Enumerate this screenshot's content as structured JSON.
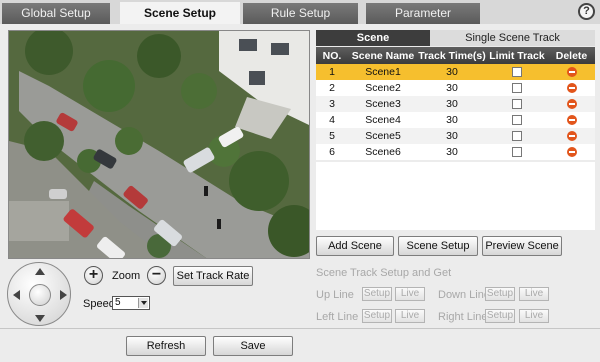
{
  "tabs": [
    {
      "label": "Global Setup"
    },
    {
      "label": "Scene Setup"
    },
    {
      "label": "Rule Setup"
    },
    {
      "label": "Parameter"
    }
  ],
  "help_label": "?",
  "ptz": {
    "zoom_label": "Zoom",
    "zoom_in": "+",
    "zoom_out": "−",
    "set_track_rate": "Set Track Rate",
    "speed_label": "Speed",
    "speed_value": "5"
  },
  "scene_tabs": {
    "scene": "Scene",
    "single": "Single Scene Track"
  },
  "table": {
    "headers": [
      "NO.",
      "Scene Name",
      "Track Time(s)",
      "Limit Track",
      "Delete"
    ],
    "rows": [
      {
        "no": "1",
        "name": "Scene1",
        "time": "30"
      },
      {
        "no": "2",
        "name": "Scene2",
        "time": "30"
      },
      {
        "no": "3",
        "name": "Scene3",
        "time": "30"
      },
      {
        "no": "4",
        "name": "Scene4",
        "time": "30"
      },
      {
        "no": "5",
        "name": "Scene5",
        "time": "30"
      },
      {
        "no": "6",
        "name": "Scene6",
        "time": "30"
      }
    ]
  },
  "actions": {
    "add_scene": "Add Scene",
    "scene_setup": "Scene Setup",
    "preview_scene": "Preview Scene"
  },
  "track": {
    "title": "Scene Track Setup and Get",
    "up_line": "Up Line",
    "down_line": "Down Line",
    "left_line": "Left Line",
    "right_line": "Right Line",
    "setup": "Setup",
    "live": "Live"
  },
  "footer": {
    "refresh": "Refresh",
    "save": "Save"
  },
  "colors": {
    "selected_row": "#f6bf2e",
    "delete_icon": "#e2551b",
    "active_subtab": "#3d3d3d"
  }
}
